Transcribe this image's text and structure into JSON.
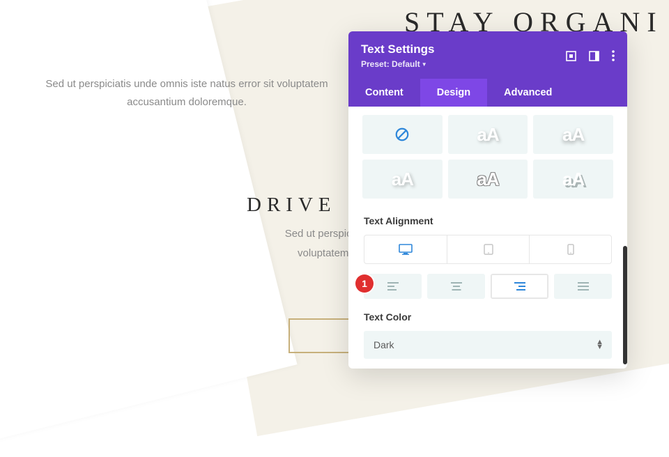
{
  "page": {
    "heroTitle": "STAY ORGANI",
    "heroSub": "Sed ut perspiciatis unde omnis iste natus error sit voluptatem accusantium doloremque.",
    "secondTitle": "DRIVE",
    "secondSub1": "Sed ut perspiciatis",
    "secondSub2": "voluptatem a"
  },
  "badge": {
    "one": "1"
  },
  "panel": {
    "title": "Text Settings",
    "presetLabel": "Preset: Default",
    "tabs": {
      "content": "Content",
      "design": "Design",
      "advanced": "Advanced"
    },
    "sections": {
      "textAlignment": "Text Alignment",
      "textColor": "Text Color"
    },
    "textColorValue": "Dark"
  }
}
